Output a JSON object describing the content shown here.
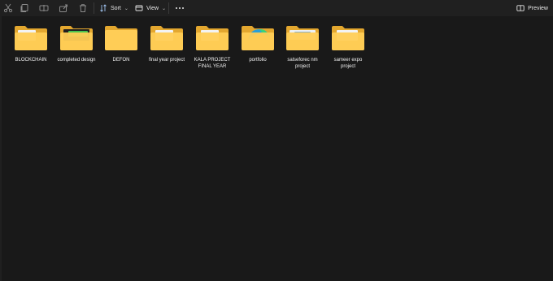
{
  "toolbar": {
    "sort_label": "Sort",
    "view_label": "View",
    "preview_label": "Preview",
    "icons": [
      "cut-icon",
      "copy-icon",
      "rename-icon",
      "share-icon",
      "delete-icon"
    ]
  },
  "folders": [
    {
      "name": "BLOCKCHAIN",
      "thumbnail": "document"
    },
    {
      "name": "completed design",
      "thumbnail": "green-document"
    },
    {
      "name": "DEFON",
      "thumbnail": "none"
    },
    {
      "name": "final year project",
      "thumbnail": "document"
    },
    {
      "name": "KALA PROJECT FINAL YEAR",
      "thumbnail": "document"
    },
    {
      "name": "portfolio",
      "thumbnail": "edge-logo"
    },
    {
      "name": "salseforec nm project",
      "thumbnail": "wide-document"
    },
    {
      "name": "sameer expo project",
      "thumbnail": "document"
    }
  ],
  "colors": {
    "background": "#191919",
    "toolbar": "#202020",
    "folder_back": "#E3A72F",
    "folder_front": "#FFCD56"
  }
}
